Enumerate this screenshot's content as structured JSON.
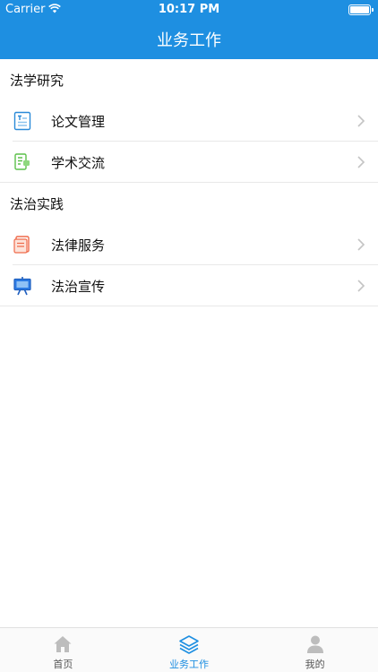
{
  "status": {
    "carrier": "Carrier",
    "time": "10:17 PM"
  },
  "nav": {
    "title": "业务工作"
  },
  "sections": [
    {
      "title": "法学研究",
      "items": [
        {
          "label": "论文管理",
          "icon": "document-text-icon"
        },
        {
          "label": "学术交流",
          "icon": "chat-document-icon"
        }
      ]
    },
    {
      "title": "法治实践",
      "items": [
        {
          "label": "法律服务",
          "icon": "service-document-icon"
        },
        {
          "label": "法治宣传",
          "icon": "presentation-board-icon"
        }
      ]
    }
  ],
  "tabs": [
    {
      "label": "首页",
      "icon": "home-icon",
      "active": false
    },
    {
      "label": "业务工作",
      "icon": "layers-icon",
      "active": true
    },
    {
      "label": "我的",
      "icon": "person-icon",
      "active": false
    }
  ],
  "colors": {
    "accent": "#1e8fe1"
  }
}
